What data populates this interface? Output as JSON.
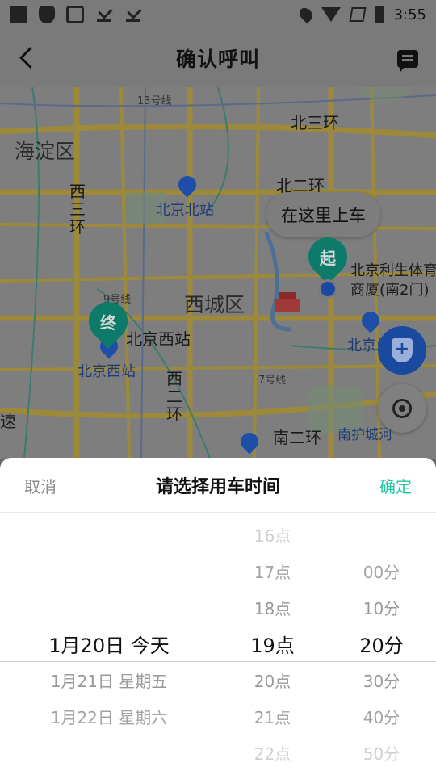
{
  "status_bar": {
    "time": "3:55"
  },
  "header": {
    "title": "确认呼叫"
  },
  "map": {
    "pickup_bubble": "在这里上车",
    "start_pin": "起",
    "end_pin": "终",
    "labels": {
      "haidian": "海淀区",
      "xicheng": "西城区",
      "beisanhuan": "北三环",
      "beierhuan": "北二环",
      "xisanhuan": "西三环",
      "xierhuan": "西二环",
      "nanerhuan": "南二环",
      "nanhuchengshe": "南护城河",
      "beijingbeizhan_station": "北京北站",
      "beijingxizhan_station": "北京西站",
      "beijingxizhan_label": "北京西站",
      "beijingzhan": "北京站",
      "poi_name": "北京利生体育商厦(南2门)",
      "line13": "13号线",
      "line9": "9号线",
      "line7": "7号线",
      "expressway": "速"
    }
  },
  "sheet": {
    "cancel": "取消",
    "title": "请选择用车时间",
    "confirm": "确定"
  },
  "picker": {
    "dates": [
      {
        "label": "1月20日  今天",
        "state": "selected"
      },
      {
        "label": "1月21日 星期五",
        "state": "near"
      },
      {
        "label": "1月22日 星期六",
        "state": "far"
      }
    ],
    "hours": [
      {
        "label": "16点",
        "state": "faint"
      },
      {
        "label": "17点",
        "state": "mid"
      },
      {
        "label": "18点",
        "state": "near"
      },
      {
        "label": "19点",
        "state": "selected"
      },
      {
        "label": "20点",
        "state": "near"
      },
      {
        "label": "21点",
        "state": "mid"
      },
      {
        "label": "22点",
        "state": "faint"
      }
    ],
    "minutes": [
      {
        "label": "00分",
        "state": "mid"
      },
      {
        "label": "10分",
        "state": "near"
      },
      {
        "label": "20分",
        "state": "selected"
      },
      {
        "label": "30分",
        "state": "near"
      },
      {
        "label": "40分",
        "state": "mid"
      },
      {
        "label": "50分",
        "state": "faint"
      }
    ]
  }
}
